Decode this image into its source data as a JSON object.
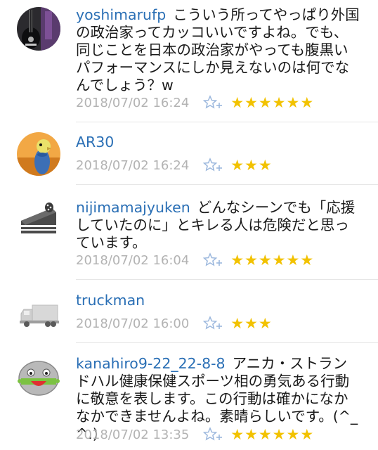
{
  "colors": {
    "username": "#2a6fb5",
    "date": "#b3b3b3",
    "star": "#f2c200",
    "fav_icon": "#9bb7dd"
  },
  "comments": [
    {
      "user": "yoshimarufp",
      "text": "こういう所ってやっぱり外国の政治家ってカッコいいですよね。でも、同じことを日本の政治家がやっても腹黒いパフォーマンスにしか見えないのは何でなんでしょう？w",
      "date": "2018/07/02 16:24",
      "stars": "★★★★★★",
      "rating": 6,
      "avatar_icon": "guitar-photo-avatar"
    },
    {
      "user": "AR30",
      "text": "",
      "date": "2018/07/02 16:24",
      "stars": "★★★",
      "rating": 3,
      "avatar_icon": "parakeet-photo-avatar"
    },
    {
      "user": "nijimamajyuken",
      "text": "どんなシーンでも「応援していたのに」とキレる人は危険だと思っています。",
      "date": "2018/07/02 16:04",
      "stars": "★★★★★★",
      "rating": 6,
      "avatar_icon": "cake-slice-avatar"
    },
    {
      "user": "truckman",
      "text": "",
      "date": "2018/07/02 16:00",
      "stars": "★★★",
      "rating": 3,
      "avatar_icon": "truck-avatar"
    },
    {
      "user": "kanahiro9-22_22-8-8",
      "text": "アニカ・ストランドハル健康保健スポーツ相の勇気ある行動に敬意を表します。この行動は確かになかなかできませんよね。素晴らしいです。(^_^.)",
      "date": "2018/07/02 13:35",
      "stars": "★★★★★★",
      "rating": 6,
      "avatar_icon": "robot-face-avatar"
    }
  ]
}
